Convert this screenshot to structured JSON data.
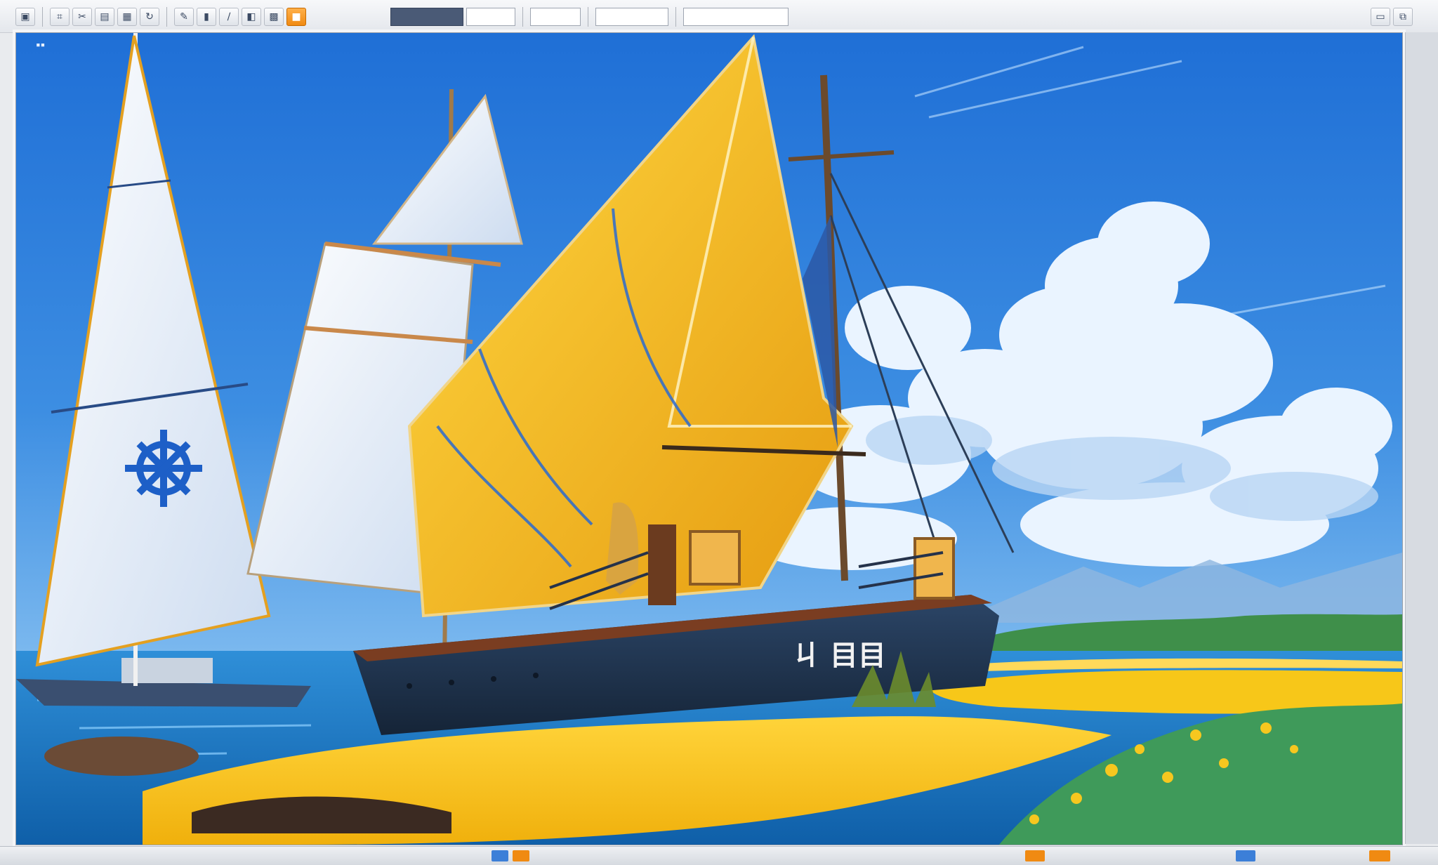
{
  "toolbar": {
    "buttons": [
      {
        "icon": "image-icon",
        "glyph": "▣"
      },
      {
        "icon": "crop-icon",
        "glyph": "⌗"
      },
      {
        "icon": "scissors-icon",
        "glyph": "✂"
      },
      {
        "icon": "clipboard-icon",
        "glyph": "▤"
      },
      {
        "icon": "grid-icon",
        "glyph": "▦"
      },
      {
        "icon": "rotate-icon",
        "glyph": "↻"
      },
      {
        "icon": "pencil-icon",
        "glyph": "✎"
      },
      {
        "icon": "brush-icon",
        "glyph": "▮"
      },
      {
        "icon": "line-icon",
        "glyph": "∕"
      },
      {
        "icon": "shape-icon",
        "glyph": "◧"
      },
      {
        "icon": "fill-icon",
        "glyph": "▩"
      },
      {
        "icon": "color-swatch-icon",
        "glyph": "■"
      }
    ],
    "right_buttons": [
      {
        "icon": "window-icon",
        "glyph": "▭"
      },
      {
        "icon": "restore-icon",
        "glyph": "⧉"
      }
    ]
  },
  "canvas": {
    "hull_text": "ㄐ 目目"
  },
  "colors": {
    "sky_top": "#1f6fd6",
    "sky_bottom": "#6fb2f0",
    "sea": "#1e78c8",
    "sand": "#f5c21a",
    "grass": "#3f9a5a",
    "hull": "#233a57",
    "sail_yellow": "#f3b81c",
    "sail_white": "#f4f6fa",
    "accent_orange": "#f08a12"
  }
}
